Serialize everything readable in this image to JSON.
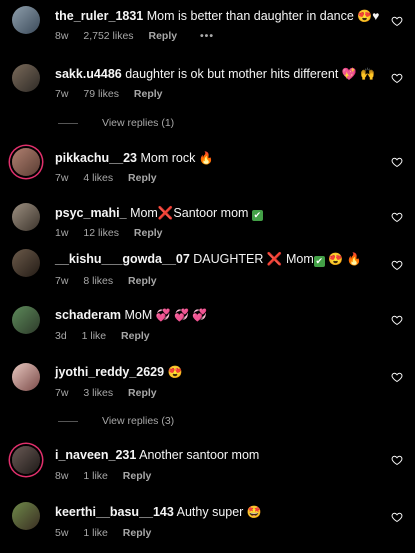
{
  "comments": [
    {
      "user": "the_ruler_1831",
      "text": "Mom is better than daughter in dance",
      "emoji": "😍♥",
      "age": "8w",
      "likes": "2,752 likes",
      "reply": "Reply",
      "more": "•••"
    },
    {
      "user": "sakk.u4486",
      "text": "daughter is ok but mother hits different",
      "emoji": "💖 🙌",
      "age": "7w",
      "likes": "79 likes",
      "reply": "Reply"
    },
    {
      "user": "pikkachu__23",
      "text": "Mom rock",
      "emoji": "🔥",
      "age": "7w",
      "likes": "4 likes",
      "reply": "Reply"
    },
    {
      "user": "psyc_mahi_",
      "text": "Mom",
      "emoji_x": "❌",
      "text2": "Santoor mom",
      "emoji_check": "✔",
      "age": "1w",
      "likes": "12 likes",
      "reply": "Reply"
    },
    {
      "user": "__kishu___gowda__07",
      "text": "DAUGHTER",
      "emoji_x": "❌",
      "text2": "Mom",
      "emoji_check": "✔",
      "emoji": "😍 🔥",
      "age": "7w",
      "likes": "8 likes",
      "reply": "Reply"
    },
    {
      "user": "schaderam",
      "text": "MoM",
      "emoji": "💞 💞 💞",
      "age": "3d",
      "likes": "1 like",
      "reply": "Reply"
    },
    {
      "user": "jyothi_reddy_2629",
      "text": "",
      "emoji": "😍",
      "age": "7w",
      "likes": "3 likes",
      "reply": "Reply"
    },
    {
      "user": "i_naveen_231",
      "text": "Another santoor mom",
      "emoji": "",
      "age": "8w",
      "likes": "1 like",
      "reply": "Reply"
    },
    {
      "user": "keerthi__basu__143",
      "text": "Authy super",
      "emoji": "🤩",
      "age": "5w",
      "likes": "1 like",
      "reply": "Reply"
    }
  ],
  "view_replies": [
    "View replies (1)",
    "View replies (3)"
  ],
  "colors": {
    "background": "#000000",
    "text": "#f5f5f5",
    "meta": "#a8a8a8",
    "story_ring": "#e1306c"
  }
}
